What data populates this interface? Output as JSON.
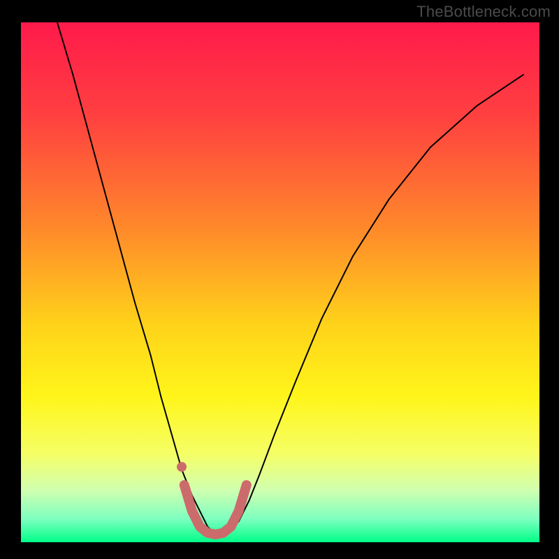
{
  "watermark": "TheBottleneck.com",
  "chart_data": {
    "type": "line",
    "title": "",
    "xlabel": "",
    "ylabel": "",
    "xlim": [
      0,
      100
    ],
    "ylim": [
      0,
      100
    ],
    "legend": false,
    "grid": false,
    "background_gradient_stops": [
      {
        "offset": 0.0,
        "color": "#ff1a4b"
      },
      {
        "offset": 0.18,
        "color": "#ff4040"
      },
      {
        "offset": 0.4,
        "color": "#ff8a2a"
      },
      {
        "offset": 0.58,
        "color": "#ffd21a"
      },
      {
        "offset": 0.72,
        "color": "#fff51a"
      },
      {
        "offset": 0.83,
        "color": "#f5ff66"
      },
      {
        "offset": 0.9,
        "color": "#d0ffb0"
      },
      {
        "offset": 0.955,
        "color": "#7effc0"
      },
      {
        "offset": 1.0,
        "color": "#00ff88"
      }
    ],
    "series": [
      {
        "name": "bottleneck-curve",
        "color": "#000000",
        "stroke_width": 2,
        "x": [
          7,
          10,
          13,
          16,
          19,
          22,
          25,
          27,
          29,
          31,
          33,
          35,
          36,
          37,
          38,
          39,
          40,
          42,
          44,
          46,
          49,
          53,
          58,
          64,
          71,
          79,
          88,
          97
        ],
        "y": [
          100,
          90,
          79,
          68,
          57,
          46,
          36,
          28,
          21,
          14,
          9,
          5,
          3,
          2,
          1.5,
          1.5,
          2,
          4,
          8,
          13,
          21,
          31,
          43,
          55,
          66,
          76,
          84,
          90
        ]
      },
      {
        "name": "sweet-spot-highlight",
        "color": "#cc6b6b",
        "stroke_width": 14,
        "linecap": "round",
        "x": [
          31.5,
          33,
          34.5,
          36,
          37.5,
          39,
          40.5,
          42,
          43.5
        ],
        "y": [
          11,
          6,
          3,
          1.8,
          1.5,
          1.8,
          3,
          6,
          11
        ]
      }
    ],
    "markers": [
      {
        "name": "sweet-spot-dot",
        "x": 31,
        "y": 14.5,
        "r": 7,
        "color": "#cc6b6b"
      }
    ]
  }
}
